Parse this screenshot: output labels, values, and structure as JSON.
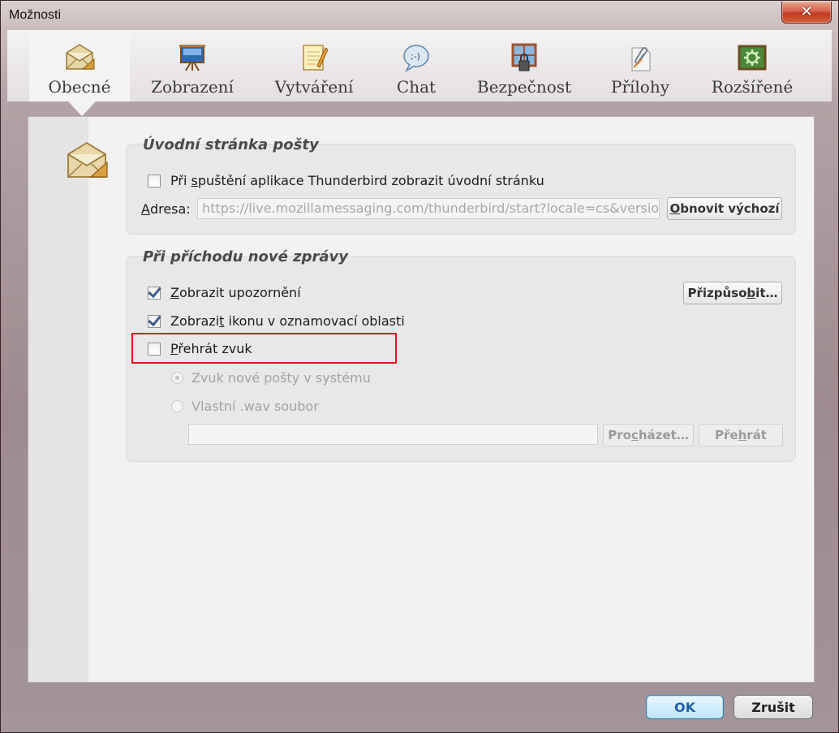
{
  "window": {
    "title": "Možnosti"
  },
  "tabs": [
    {
      "label": "Obecné",
      "icon": "envelope-icon",
      "selected": true
    },
    {
      "label": "Zobrazení",
      "icon": "easel-icon",
      "selected": false
    },
    {
      "label": "Vytváření",
      "icon": "notepad-pencil-icon",
      "selected": false
    },
    {
      "label": "Chat",
      "icon": "chat-bubble-icon",
      "selected": false
    },
    {
      "label": "Bezpečnost",
      "icon": "lock-window-icon",
      "selected": false
    },
    {
      "label": "Přílohy",
      "icon": "paperclip-icon",
      "selected": false
    },
    {
      "label": "Rozšířené",
      "icon": "gear-board-icon",
      "selected": false
    }
  ],
  "start_page": {
    "title": "Úvodní stránka pošty",
    "show_start_page": {
      "label_pre": "Při ",
      "label_key": "s",
      "label_post": "puštění aplikace Thunderbird zobrazit úvodní stránku",
      "checked": false
    },
    "address_label_key": "A",
    "address_label_rest": "dresa:",
    "address_value": "https://live.mozillamessaging.com/thunderbird/start?locale=cs&version",
    "restore_key": "O",
    "restore_rest": "bnovit výchozí"
  },
  "new_message": {
    "title": "Při příchodu nové zprávy",
    "show_alert": {
      "label_pre": "Zobrazit upozornění",
      "checked": true
    },
    "customize_pre": "Přizpůso",
    "customize_key": "b",
    "customize_post": "it…",
    "show_tray": {
      "label_pre": "Zobrazi",
      "label_key": "t",
      "label_post": " ikonu v oznamovací oblasti",
      "checked": true
    },
    "play_sound": {
      "label_key": "P",
      "label_post": "řehrát zvuk",
      "checked": false
    },
    "system_sound": {
      "label": "Zvuk nové pošty v systému",
      "selected": true
    },
    "custom_wav": {
      "label": "Vlastní .wav soubor",
      "selected": false
    },
    "sound_file_value": "",
    "browse_pre": "Pro",
    "browse_key": "c",
    "browse_post": "házet…",
    "play_pre": "Pře",
    "play_key": "h",
    "play_post": "rát"
  },
  "footer": {
    "ok": "OK",
    "cancel": "Zrušit"
  },
  "colors": {
    "highlight": "#e0121b",
    "check": "#3b5c8c",
    "ok_text": "#1f5ea8"
  }
}
